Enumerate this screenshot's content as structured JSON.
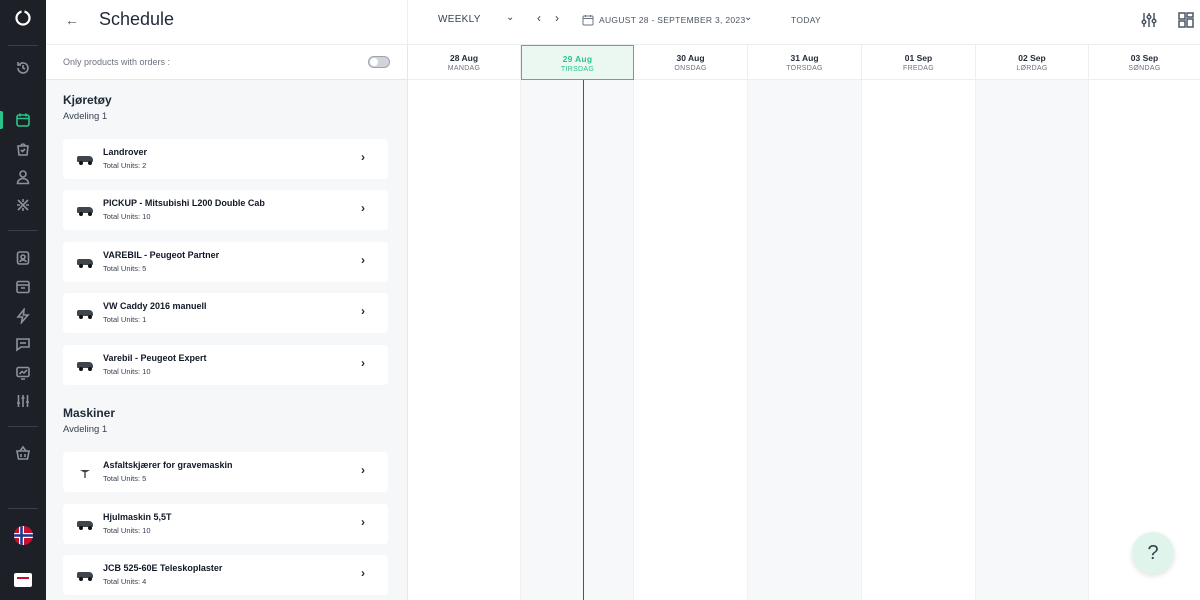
{
  "header": {
    "back_label": "←",
    "title": "Schedule",
    "view_mode": "WEEKLY",
    "view_chev": "⌄",
    "prev": "‹",
    "next": "›",
    "date_range": "AUGUST 28 - SEPTEMBER 3, 2023",
    "range_chev": "⌄",
    "today": "TODAY"
  },
  "filter": {
    "label": "Only products with orders :",
    "enabled": false
  },
  "groups": [
    {
      "title": "Kjøretøy",
      "subtitle": "Avdeling 1",
      "items": [
        {
          "name": "Landrover",
          "units": "Total Units: 2"
        },
        {
          "name": "PICKUP - Mitsubishi L200 Double Cab",
          "units": "Total Units: 10"
        },
        {
          "name": "VAREBIL - Peugeot Partner",
          "units": "Total Units: 5"
        },
        {
          "name": "VW Caddy 2016 manuell",
          "units": "Total Units: 1"
        },
        {
          "name": "Varebil - Peugeot Expert",
          "units": "Total Units: 10"
        }
      ]
    },
    {
      "title": "Maskiner",
      "subtitle": "Avdeling 1",
      "items": [
        {
          "name": "Asfaltskjærer for gravemaskin",
          "units": "Total Units: 5"
        },
        {
          "name": "Hjulmaskin 5,5T",
          "units": "Total Units: 10"
        },
        {
          "name": "JCB 525-60E Teleskoplaster",
          "units": "Total Units: 4"
        }
      ]
    }
  ],
  "days": [
    {
      "date": "28 Aug",
      "name": "MANDAG"
    },
    {
      "date": "29 Aug",
      "name": "TIRSDAG",
      "today": true
    },
    {
      "date": "30 Aug",
      "name": "ONSDAG"
    },
    {
      "date": "31 Aug",
      "name": "TORSDAG"
    },
    {
      "date": "01 Sep",
      "name": "FREDAG"
    },
    {
      "date": "02 Sep",
      "name": "LØRDAG"
    },
    {
      "date": "03 Sep",
      "name": "SØNDAG"
    }
  ],
  "chevron": "›",
  "help": "?",
  "colors": {
    "accent": "#2bc48a",
    "rail": "#1d2127",
    "panel": "#f6f7f9"
  },
  "rail_icons": [
    "history-icon",
    "calendar-icon",
    "shopping-bag-icon",
    "user-icon",
    "tools-icon",
    "contacts-icon",
    "archive-icon",
    "bolt-icon",
    "chat-icon",
    "analytics-icon",
    "sliders-icon",
    "basket-icon"
  ]
}
